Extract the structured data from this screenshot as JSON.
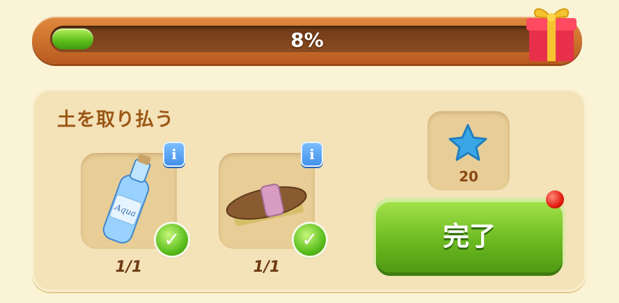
{
  "progress": {
    "percent_label": "8%",
    "fraction": 0.08
  },
  "task": {
    "title": "土を取り払う",
    "items": [
      {
        "name": "water-bottle",
        "count": "1/1",
        "info": "i"
      },
      {
        "name": "scrub-brush",
        "count": "1/1",
        "info": "i"
      }
    ]
  },
  "reward": {
    "icon": "blue-star-icon",
    "amount": "20"
  },
  "complete_button": {
    "label": "完了"
  },
  "colors": {
    "accent_green": "#6dbb22",
    "frame_orange": "#c8692a",
    "panel": "#f4e2b8"
  }
}
